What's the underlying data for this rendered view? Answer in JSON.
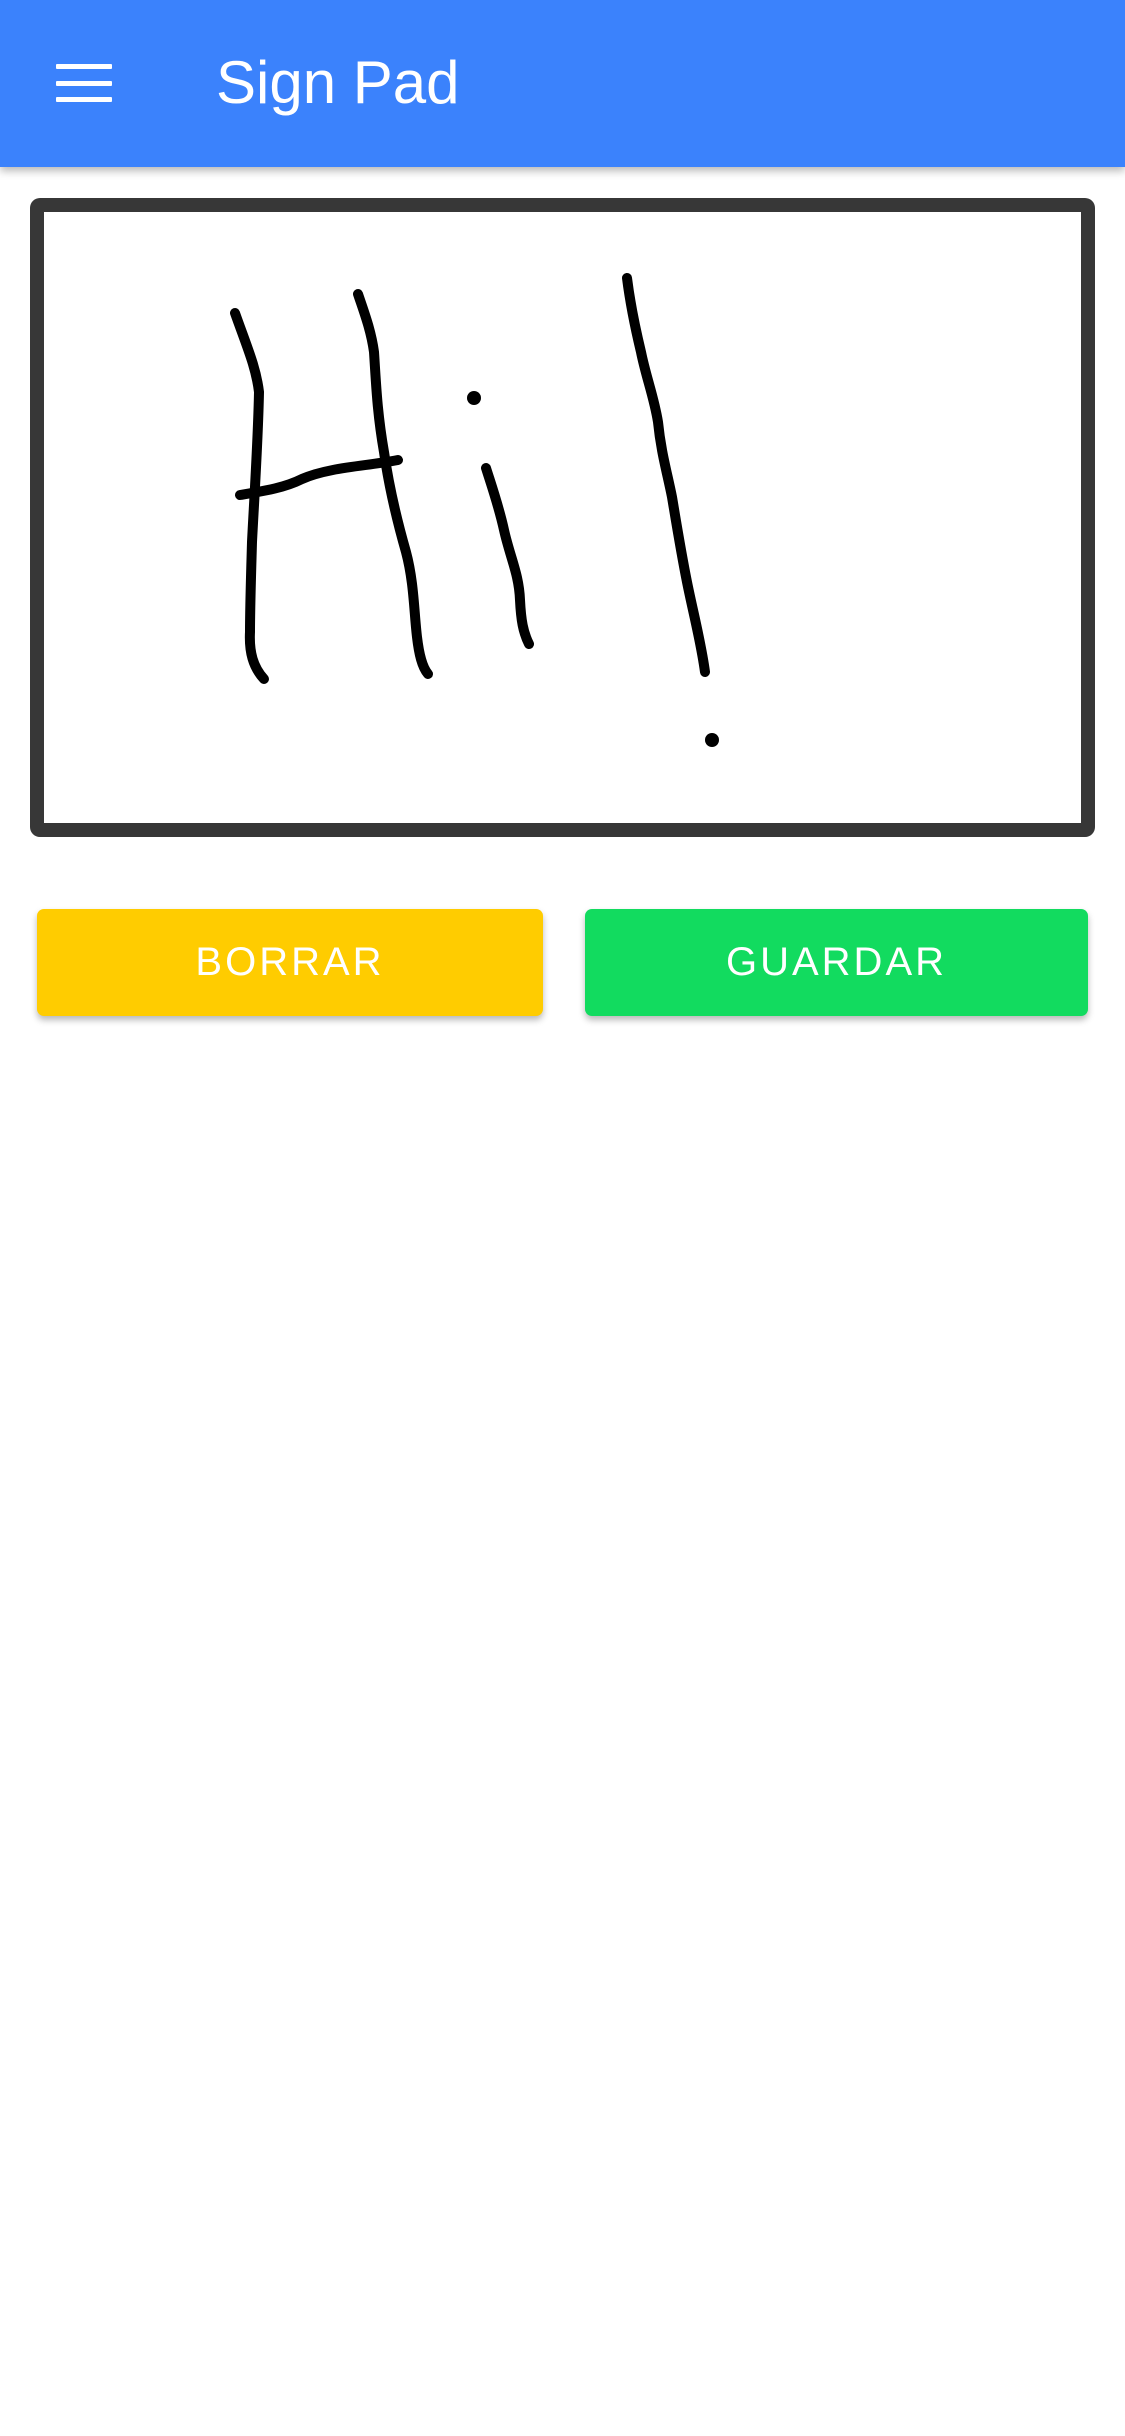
{
  "header": {
    "title": "Sign Pad",
    "menu_icon": "hamburger-menu-icon",
    "background_color": "#3b82fc"
  },
  "signature_pad": {
    "ink_color": "#000000",
    "border_color": "#373737",
    "background_color": "#ffffff",
    "has_signature": true
  },
  "actions": {
    "clear_label": "BORRAR",
    "clear_color": "#ffcc00",
    "save_label": "GUARDAR",
    "save_color": "#12db5f"
  }
}
